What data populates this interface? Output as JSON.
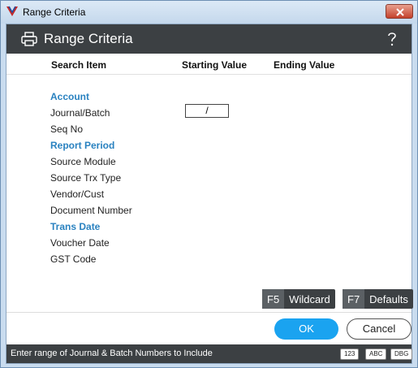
{
  "window": {
    "title": "Range Criteria"
  },
  "header": {
    "title": "Range Criteria"
  },
  "columns": {
    "search_item": "Search Item",
    "starting_value": "Starting Value",
    "ending_value": "Ending Value"
  },
  "rows": [
    {
      "label": "Account",
      "kind": "section"
    },
    {
      "label": "Journal/Batch",
      "kind": "item"
    },
    {
      "label": "Seq No",
      "kind": "item"
    },
    {
      "label": "Report Period",
      "kind": "section"
    },
    {
      "label": "Source Module",
      "kind": "item"
    },
    {
      "label": "Source Trx Type",
      "kind": "item"
    },
    {
      "label": "Vendor/Cust",
      "kind": "item"
    },
    {
      "label": "Document Number",
      "kind": "item"
    },
    {
      "label": "Trans Date",
      "kind": "section"
    },
    {
      "label": "Voucher Date",
      "kind": "item"
    },
    {
      "label": "GST Code",
      "kind": "item"
    }
  ],
  "journal_batch_start": "/",
  "buttons": {
    "wildcard_key": "F5",
    "wildcard_label": "Wildcard",
    "defaults_key": "F7",
    "defaults_label": "Defaults",
    "ok": "OK",
    "cancel": "Cancel"
  },
  "status": {
    "message": "Enter range of Journal & Batch Numbers to Include",
    "badges": [
      "123",
      "ABC",
      "DBG"
    ]
  },
  "colors": {
    "section": "#2a82c0",
    "ok_button": "#1aa3f0",
    "header_bg": "#3c4043"
  },
  "icons": {
    "app": "app-logo-icon",
    "close": "close-icon",
    "print": "printer-icon",
    "help": "help-icon"
  }
}
